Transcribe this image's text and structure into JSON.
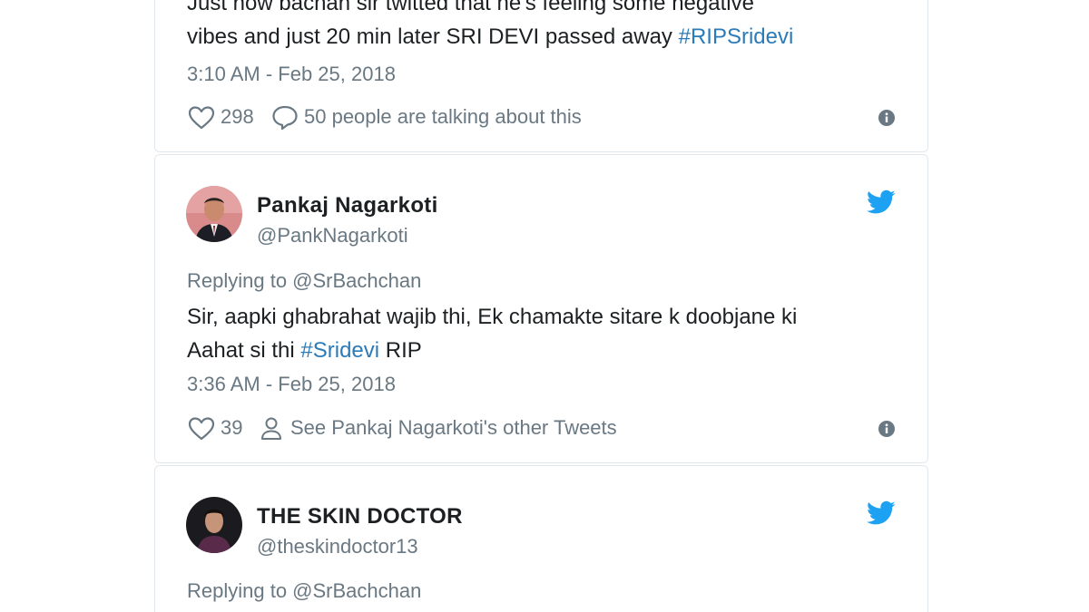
{
  "tweets": [
    {
      "text_line1": "Just now bachan sir twitted that he's feeling some negative",
      "text_line2_plain": "vibes and just 20 min later SRI DEVI passed away ",
      "text_line2_hashtag": "#RIPSridevi",
      "timestamp": "3:10 AM - Feb 25, 2018",
      "likes": "298",
      "secondary_action": "50 people are talking about this"
    },
    {
      "author_name": "Pankaj Nagarkoti",
      "author_handle": "@PankNagarkoti",
      "replying_to": "Replying to @SrBachchan",
      "text_line1": "Sir, aapki ghabrahat wajib thi, Ek chamakte sitare k doobjane ki",
      "text_line2_plain": "Aahat si thi ",
      "text_line2_hashtag": "#Sridevi",
      "text_line2_suffix": " RIP",
      "timestamp": "3:36 AM - Feb 25, 2018",
      "likes": "39",
      "secondary_action": "See Pankaj Nagarkoti's other Tweets"
    },
    {
      "author_name": "THE SKIN DOCTOR",
      "author_handle": "@theskindoctor13",
      "replying_to": "Replying to @SrBachchan"
    }
  ],
  "colors": {
    "hashtag": "#2b7bb9",
    "muted": "#697882",
    "twitter_blue": "#1da1f2",
    "border": "#e1e8ed"
  },
  "icons": {
    "like": "heart-icon",
    "comment": "speech-bubble-icon",
    "profile": "person-icon",
    "info": "info-icon",
    "brand": "twitter-bird-icon"
  }
}
